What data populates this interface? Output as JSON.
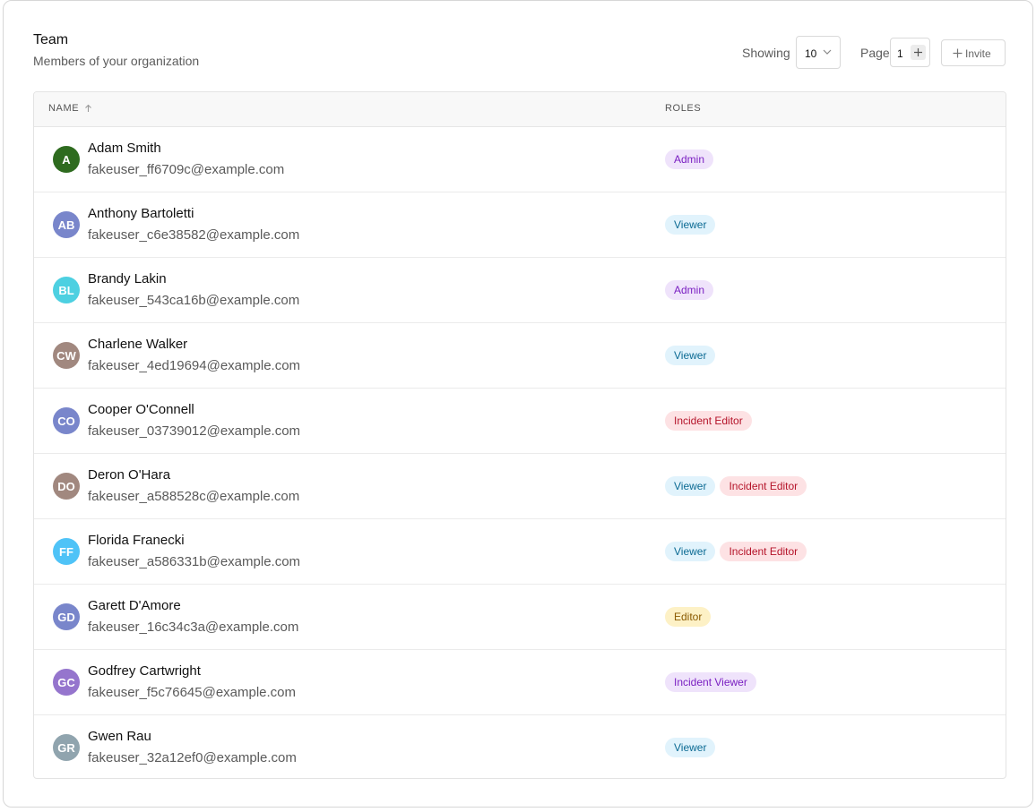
{
  "header": {
    "title": "Team",
    "subtitle": "Members of your organization"
  },
  "controls": {
    "showing_label": "Showing",
    "page_size": "10",
    "page_label": "Page",
    "page_number": "1",
    "invite_label": "Invite"
  },
  "table": {
    "columns": {
      "name": "NAME",
      "roles": "ROLES"
    },
    "sort": {
      "column": "name",
      "direction": "ascending"
    },
    "rows": [
      {
        "initials": "A",
        "avatar_color": "#2e6b1f",
        "name": "Adam Smith",
        "email": "fakeuser_ff6709c@example.com",
        "roles": [
          "Admin"
        ]
      },
      {
        "initials": "AB",
        "avatar_color": "#7986cb",
        "name": "Anthony Bartoletti",
        "email": "fakeuser_c6e38582@example.com",
        "roles": [
          "Viewer"
        ]
      },
      {
        "initials": "BL",
        "avatar_color": "#4dd0e1",
        "name": "Brandy Lakin",
        "email": "fakeuser_543ca16b@example.com",
        "roles": [
          "Admin"
        ]
      },
      {
        "initials": "CW",
        "avatar_color": "#a1887f",
        "name": "Charlene Walker",
        "email": "fakeuser_4ed19694@example.com",
        "roles": [
          "Viewer"
        ]
      },
      {
        "initials": "CO",
        "avatar_color": "#7986cb",
        "name": "Cooper O'Connell",
        "email": "fakeuser_03739012@example.com",
        "roles": [
          "Incident Editor"
        ]
      },
      {
        "initials": "DO",
        "avatar_color": "#a1887f",
        "name": "Deron O'Hara",
        "email": "fakeuser_a588528c@example.com",
        "roles": [
          "Viewer",
          "Incident Editor"
        ]
      },
      {
        "initials": "FF",
        "avatar_color": "#4fc3f7",
        "name": "Florida Franecki",
        "email": "fakeuser_a586331b@example.com",
        "roles": [
          "Viewer",
          "Incident Editor"
        ]
      },
      {
        "initials": "GD",
        "avatar_color": "#7986cb",
        "name": "Garett D'Amore",
        "email": "fakeuser_16c34c3a@example.com",
        "roles": [
          "Editor"
        ]
      },
      {
        "initials": "GC",
        "avatar_color": "#9575cd",
        "name": "Godfrey Cartwright",
        "email": "fakeuser_f5c76645@example.com",
        "roles": [
          "Incident Viewer"
        ]
      },
      {
        "initials": "GR",
        "avatar_color": "#90a4ae",
        "name": "Gwen Rau",
        "email": "fakeuser_32a12ef0@example.com",
        "roles": [
          "Viewer"
        ]
      }
    ]
  },
  "role_colors": {
    "Admin": {
      "bg": "#efe3fb",
      "fg": "#7a1fc2"
    },
    "Viewer": {
      "bg": "#e1f3fc",
      "fg": "#0b6a93"
    },
    "Incident Editor": {
      "bg": "#fde2e4",
      "fg": "#b5142a"
    },
    "Editor": {
      "bg": "#fdf1c6",
      "fg": "#8a5a00"
    },
    "Incident Viewer": {
      "bg": "#efe3fb",
      "fg": "#7a1fc2"
    }
  }
}
